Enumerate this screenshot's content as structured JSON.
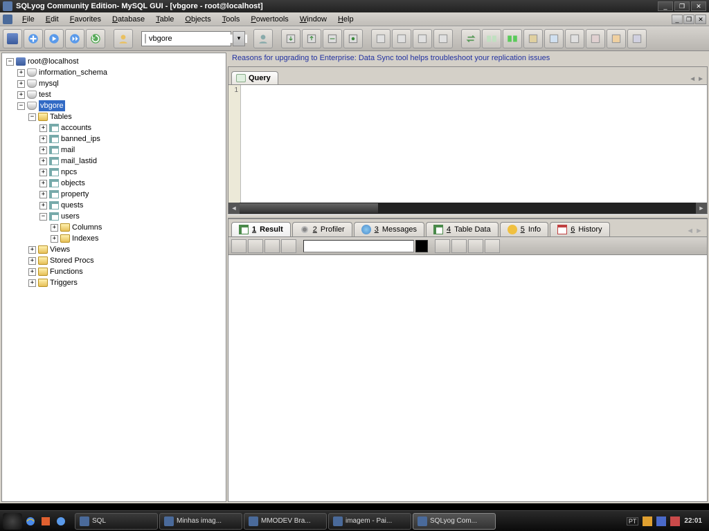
{
  "titlebar": {
    "title": "SQLyog Community Edition- MySQL GUI - [vbgore - root@localhost]"
  },
  "menus": [
    "File",
    "Edit",
    "Favorites",
    "Database",
    "Table",
    "Objects",
    "Tools",
    "Powertools",
    "Window",
    "Help"
  ],
  "db_selector": "vbgore",
  "promo": "Reasons for upgrading to Enterprise: Data Sync tool helps troubleshoot your replication issues",
  "query_tab": "Query",
  "gutter_line": "1",
  "result_tabs": [
    {
      "num": "1",
      "label": "Result",
      "icon": "grid"
    },
    {
      "num": "2",
      "label": "Profiler",
      "icon": "gear"
    },
    {
      "num": "3",
      "label": "Messages",
      "icon": "globe"
    },
    {
      "num": "4",
      "label": "Table Data",
      "icon": "grid"
    },
    {
      "num": "5",
      "label": "Info",
      "icon": "info"
    },
    {
      "num": "6",
      "label": "History",
      "icon": "cal"
    }
  ],
  "tree": {
    "root": "root@localhost",
    "dbs": [
      {
        "name": "information_schema",
        "expanded": false
      },
      {
        "name": "mysql",
        "expanded": false
      },
      {
        "name": "test",
        "expanded": false
      },
      {
        "name": "vbgore",
        "expanded": true,
        "selected": true,
        "children": [
          {
            "name": "Tables",
            "type": "folder",
            "expanded": true,
            "children": [
              {
                "name": "accounts",
                "type": "table"
              },
              {
                "name": "banned_ips",
                "type": "table"
              },
              {
                "name": "mail",
                "type": "table"
              },
              {
                "name": "mail_lastid",
                "type": "table"
              },
              {
                "name": "npcs",
                "type": "table"
              },
              {
                "name": "objects",
                "type": "table"
              },
              {
                "name": "property",
                "type": "table"
              },
              {
                "name": "quests",
                "type": "table"
              },
              {
                "name": "users",
                "type": "table",
                "expanded": true,
                "children": [
                  {
                    "name": "Columns",
                    "type": "folder"
                  },
                  {
                    "name": "Indexes",
                    "type": "folder"
                  }
                ]
              }
            ]
          },
          {
            "name": "Views",
            "type": "folder"
          },
          {
            "name": "Stored Procs",
            "type": "folder"
          },
          {
            "name": "Functions",
            "type": "folder"
          },
          {
            "name": "Triggers",
            "type": "folder"
          }
        ]
      }
    ]
  },
  "taskbar": {
    "items": [
      {
        "label": "SQL",
        "active": false
      },
      {
        "label": "Minhas imag...",
        "active": false
      },
      {
        "label": "MMODEV Bra...",
        "active": false
      },
      {
        "label": "imagem - Pai...",
        "active": false
      },
      {
        "label": "SQLyog Com...",
        "active": true
      }
    ],
    "clock": "22:01"
  }
}
